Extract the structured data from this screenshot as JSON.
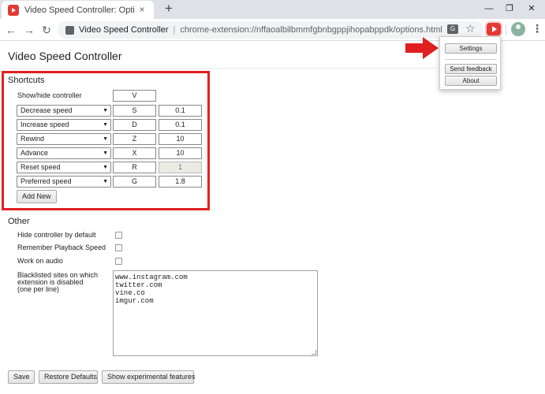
{
  "browser": {
    "tab_title": "Video Speed Controller: Options",
    "tab_close": "×",
    "new_tab": "+",
    "window_minimize": "—",
    "window_restore": "❐",
    "window_close": "✕",
    "back": "←",
    "forward": "→",
    "reload": "↻",
    "omnibox_site": "Video Speed Controller",
    "omnibox_separator": "|",
    "omnibox_url": "chrome-extension://nffaoalbilbmmfgbnbgppjihopabppdk/options.html",
    "translate_icon_text": "G",
    "bookmark_star": "☆",
    "menu_dots": "⋮"
  },
  "page": {
    "title": "Video Speed Controller"
  },
  "shortcuts": {
    "heading": "Shortcuts",
    "show_hide_label": "Show/hide controller",
    "show_hide_key": "V",
    "rows": [
      {
        "action": "Decrease speed",
        "key": "S",
        "value": "0.1"
      },
      {
        "action": "Increase speed",
        "key": "D",
        "value": "0.1"
      },
      {
        "action": "Rewind",
        "key": "Z",
        "value": "10"
      },
      {
        "action": "Advance",
        "key": "X",
        "value": "10"
      },
      {
        "action": "Reset speed",
        "key": "R",
        "value": "1"
      },
      {
        "action": "Preferred speed",
        "key": "G",
        "value": "1.8"
      }
    ],
    "add_new": "Add New"
  },
  "other": {
    "heading": "Other",
    "hide_controller": "Hide controller by default",
    "remember_speed": "Remember Playback Speed",
    "work_on_audio": "Work on audio",
    "blacklist_line1": "Blacklisted sites on which",
    "blacklist_line2": "extension is disabled",
    "blacklist_line3": "(one per line)",
    "blacklist_sites": [
      "www.instagram.com",
      "twitter.com",
      "vine.co",
      "imgur.com"
    ]
  },
  "footer": {
    "save": "Save",
    "restore_defaults": "Restore Defaults",
    "show_experimental": "Show experimental features"
  },
  "popup": {
    "settings": "Settings",
    "send_feedback": "Send feedback",
    "about": "About"
  },
  "colors": {
    "highlight": "#e02020",
    "extension_icon": "#e53935"
  }
}
